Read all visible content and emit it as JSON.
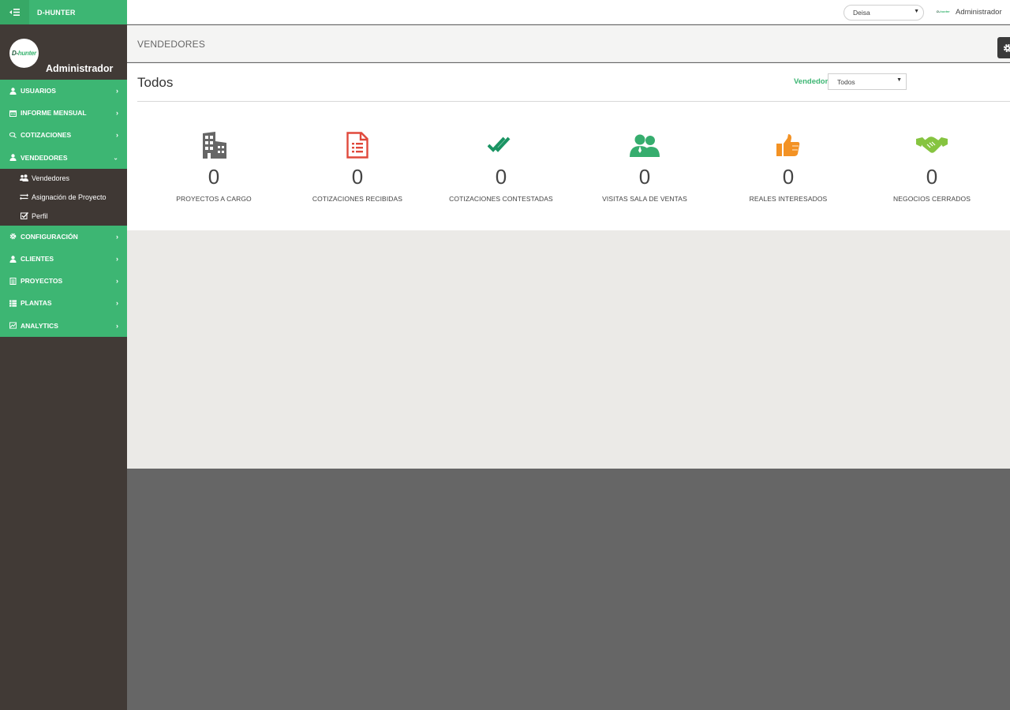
{
  "app": {
    "brand": "D-HUNTER",
    "logo_text_a": "D-",
    "logo_text_b": "hunter"
  },
  "profile": {
    "name": "Administrador"
  },
  "topbar": {
    "company_select_value": "Deisa",
    "user_name": "Administrador"
  },
  "menu": {
    "items": [
      {
        "label": "USUARIOS",
        "icon": "user-icon"
      },
      {
        "label": "INFORME MENSUAL",
        "icon": "calendar-icon"
      },
      {
        "label": "COTIZACIONES",
        "icon": "comments-icon"
      },
      {
        "label": "VENDEDORES",
        "icon": "user-icon",
        "expanded": true
      },
      {
        "label": "CONFIGURACIÓN",
        "icon": "gear-icon"
      },
      {
        "label": "CLIENTES",
        "icon": "user-icon"
      },
      {
        "label": "PROYECTOS",
        "icon": "document-icon"
      },
      {
        "label": "PLANTAS",
        "icon": "grid-icon"
      },
      {
        "label": "ANALYTICS",
        "icon": "chart-icon"
      }
    ],
    "submenu": [
      {
        "label": "Vendedores",
        "icon": "users-icon"
      },
      {
        "label": "Asignación de Proyecto",
        "icon": "exchange-icon"
      },
      {
        "label": "Perfil",
        "icon": "checkbox-icon"
      }
    ]
  },
  "page": {
    "header_title": "VENDEDORES",
    "panel_title": "Todos",
    "filter_label": "Vendedor",
    "filter_value": "Todos"
  },
  "stats": [
    {
      "value": "0",
      "label": "PROYECTOS A CARGO",
      "icon": "building-icon",
      "color": "#666666"
    },
    {
      "value": "0",
      "label": "COTIZACIONES RECIBIDAS",
      "icon": "document-list-icon",
      "color": "#e0493c"
    },
    {
      "value": "0",
      "label": "COTIZACIONES CONTESTADAS",
      "icon": "double-check-icon",
      "color": "#1a9463"
    },
    {
      "value": "0",
      "label": "VISITAS SALA DE VENTAS",
      "icon": "people-icon",
      "color": "#36ad6e"
    },
    {
      "value": "0",
      "label": "REALES INTERESADOS",
      "icon": "thumbs-up-icon",
      "color": "#f39224"
    },
    {
      "value": "0",
      "label": "NEGOCIOS CERRADOS",
      "icon": "handshake-icon",
      "color": "#86c440"
    }
  ],
  "colors": {
    "brand_green": "#3db673",
    "sidebar_dark": "#413a36",
    "content_bg": "#ebeae7",
    "footer_bg": "#666666"
  }
}
